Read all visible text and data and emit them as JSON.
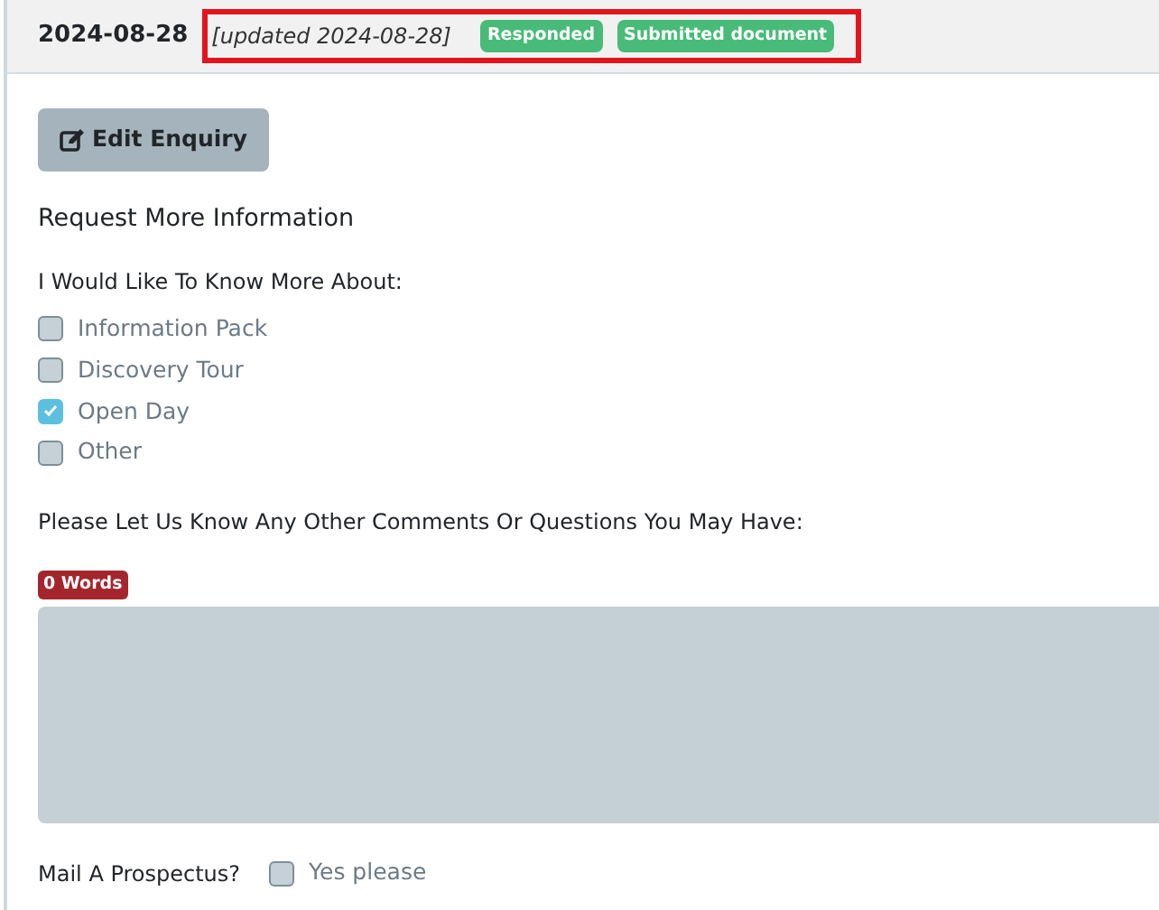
{
  "header": {
    "date": "2024-08-28",
    "updated": "[updated 2024-08-28]",
    "highlighted": true,
    "badges": [
      {
        "label": "Responded",
        "color": "#48bb78"
      },
      {
        "label": "Submitted document",
        "color": "#48bb78"
      }
    ]
  },
  "edit_button": {
    "label": "Edit Enquiry"
  },
  "section_title": "Request More Information",
  "interests": {
    "label": "I Would Like To Know More About:",
    "options": [
      {
        "label": "Information Pack",
        "checked": false
      },
      {
        "label": "Discovery Tour",
        "checked": false
      },
      {
        "label": "Open Day",
        "checked": true
      },
      {
        "label": "Other",
        "checked": false
      }
    ]
  },
  "comments": {
    "label": "Please Let Us Know Any Other Comments Or Questions You May Have:",
    "word_count": "0 Words"
  },
  "prospectus": {
    "label": "Mail A Prospectus?",
    "option": {
      "label": "Yes please",
      "checked": false
    }
  }
}
